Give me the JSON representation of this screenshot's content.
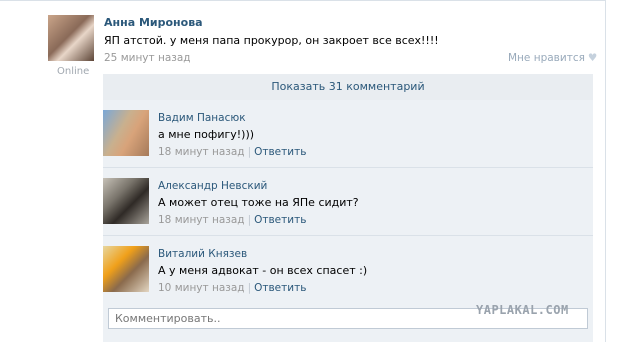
{
  "post": {
    "author": "Анна Миронова",
    "status": "Online",
    "text": "ЯП атстой. у меня папа прокурор, он закроет все всех!!!!",
    "time": "25 минут назад",
    "like_label": "Мне нравится",
    "like_icon": "heart-icon"
  },
  "show_comments_label": "Показать 31 комментарий",
  "comments": [
    {
      "author": "Вадим Панасюк",
      "text": "а мне пофигу!)))",
      "time": "18 минут назад",
      "reply": "Ответить"
    },
    {
      "author": "Александр Невский",
      "text": "А может отец тоже на ЯПе сидит?",
      "time": "18 минут назад",
      "reply": "Ответить"
    },
    {
      "author": "Виталий Князев",
      "text": "А у меня адвокат - он всех спасет :)",
      "time": "10 минут назад",
      "reply": "Ответить"
    }
  ],
  "comment_input": {
    "placeholder": "Комментировать.."
  },
  "watermark": "YAPLAKAL.COM",
  "colors": {
    "link": "#2b587a",
    "meta": "#999999",
    "panel": "#edf1f5"
  }
}
